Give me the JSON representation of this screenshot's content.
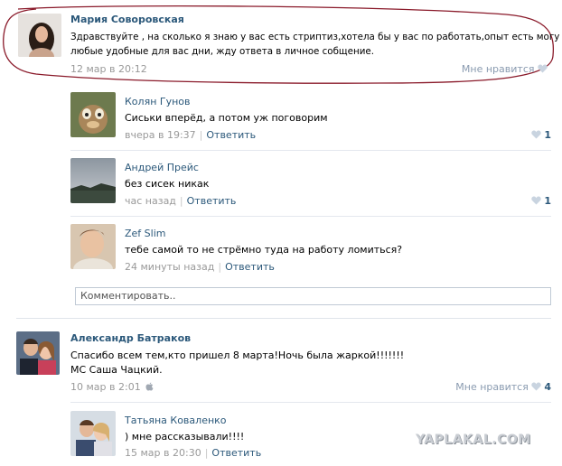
{
  "post": {
    "author": "Мария Соворовская",
    "text_line1": "Здравствуйте , на сколько я знаю у вас есть стриптиз,хотела бы у вас по работать,опыт есть могу в",
    "text_line2": "любые удобные для вас дни, жду ответа в личное собщение.",
    "time": "12 мар в 20:12",
    "like_label": "Мне нравится"
  },
  "replies": [
    {
      "author": "Колян Гунов",
      "text": "Сиськи вперёд, а потом уж поговорим",
      "time": "вчера в 19:37",
      "reply_label": "Ответить",
      "likes": "1"
    },
    {
      "author": "Андрей Прейс",
      "text": "без сисек никак",
      "time": "час назад",
      "reply_label": "Ответить",
      "likes": "1"
    },
    {
      "author": "Zef Slim",
      "text": "тебе самой то не стрёмно туда на работу ломиться?",
      "time": "24 минуты назад",
      "reply_label": "Ответить"
    }
  ],
  "comment_input": {
    "placeholder": "Комментировать.."
  },
  "post2": {
    "author": "Александр Батраков",
    "text_line1": "Спасибо всем тем,кто пришел 8 марта!Ночь была жаркой!!!!!!!",
    "text_line2": "МС Саша Чацкий.",
    "time": "10 мар в 2:01",
    "like_label": "Мне нравится",
    "likes": "4"
  },
  "reply2": {
    "author": "Татьяна Коваленко",
    "text": ") мне рассказывали!!!!",
    "time": "15 мар в 20:30",
    "reply_label": "Ответить"
  },
  "watermark": "YAPLAKAL.COM",
  "colors": {
    "link": "#2b587a",
    "meta": "#999999",
    "annotation": "#8a1a2a"
  }
}
